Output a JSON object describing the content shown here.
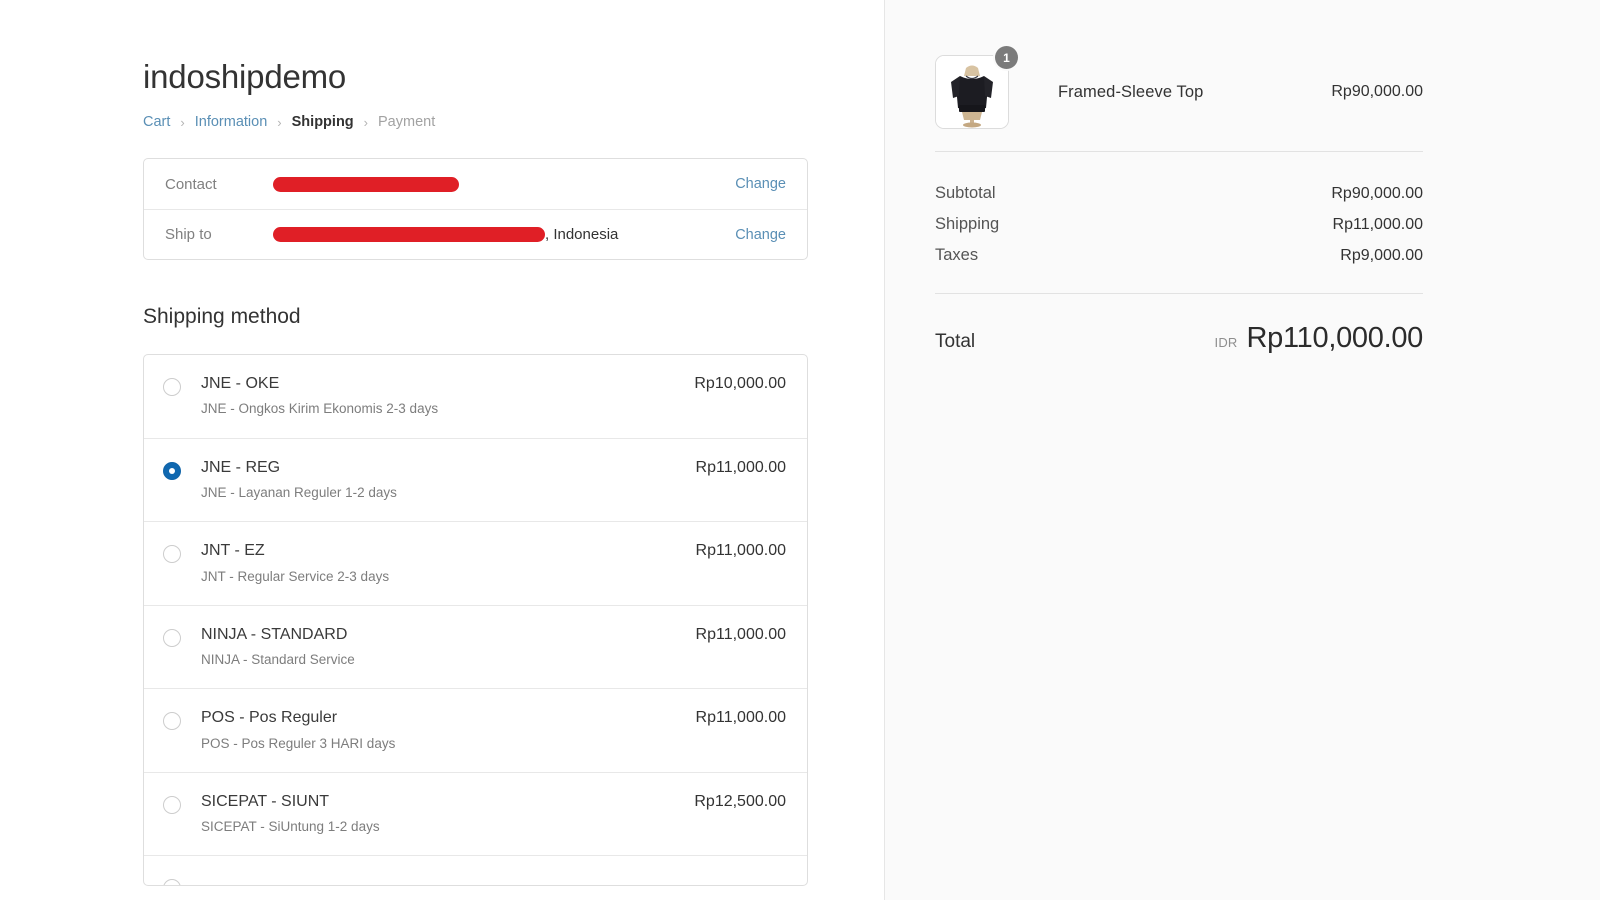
{
  "shop": {
    "name": "indoshipdemo"
  },
  "breadcrumb": {
    "separator": "›",
    "items": [
      {
        "label": "Cart",
        "state": "link"
      },
      {
        "label": "Information",
        "state": "link"
      },
      {
        "label": "Shipping",
        "state": "current"
      },
      {
        "label": "Payment",
        "state": "upcoming"
      }
    ]
  },
  "customer_info": {
    "rows": [
      {
        "label": "Contact",
        "value": "",
        "redacted": true,
        "suffix": "",
        "change_label": "Change"
      },
      {
        "label": "Ship to",
        "value": "",
        "redacted": true,
        "suffix": ", Indonesia",
        "change_label": "Change"
      }
    ]
  },
  "shipping": {
    "title": "Shipping method",
    "methods": [
      {
        "name": "JNE - OKE",
        "description": "JNE - Ongkos Kirim Ekonomis 2-3 days",
        "price": "Rp10,000.00",
        "selected": false
      },
      {
        "name": "JNE - REG",
        "description": "JNE - Layanan Reguler 1-2 days",
        "price": "Rp11,000.00",
        "selected": true
      },
      {
        "name": "JNT - EZ",
        "description": "JNT - Regular Service 2-3 days",
        "price": "Rp11,000.00",
        "selected": false
      },
      {
        "name": "NINJA - STANDARD",
        "description": "NINJA - Standard Service",
        "price": "Rp11,000.00",
        "selected": false
      },
      {
        "name": "POS - Pos Reguler",
        "description": "POS - Pos Reguler 3 HARI days",
        "price": "Rp11,000.00",
        "selected": false
      },
      {
        "name": "SICEPAT - SIUNT",
        "description": "SICEPAT - SiUntung 1-2 days",
        "price": "Rp12,500.00",
        "selected": false
      }
    ]
  },
  "order_summary": {
    "line_items": [
      {
        "title": "Framed-Sleeve Top",
        "quantity": "1",
        "price": "Rp90,000.00"
      }
    ],
    "totals": [
      {
        "label": "Subtotal",
        "value": "Rp90,000.00"
      },
      {
        "label": "Shipping",
        "value": "Rp11,000.00"
      },
      {
        "label": "Taxes",
        "value": "Rp9,000.00"
      }
    ],
    "grand_total": {
      "label": "Total",
      "currency": "IDR",
      "amount": "Rp110,000.00"
    }
  },
  "colors": {
    "link": "#5a8fb5",
    "selected_radio": "#1068b0",
    "redaction": "#e01f26",
    "panel_background": "#fafafa"
  }
}
